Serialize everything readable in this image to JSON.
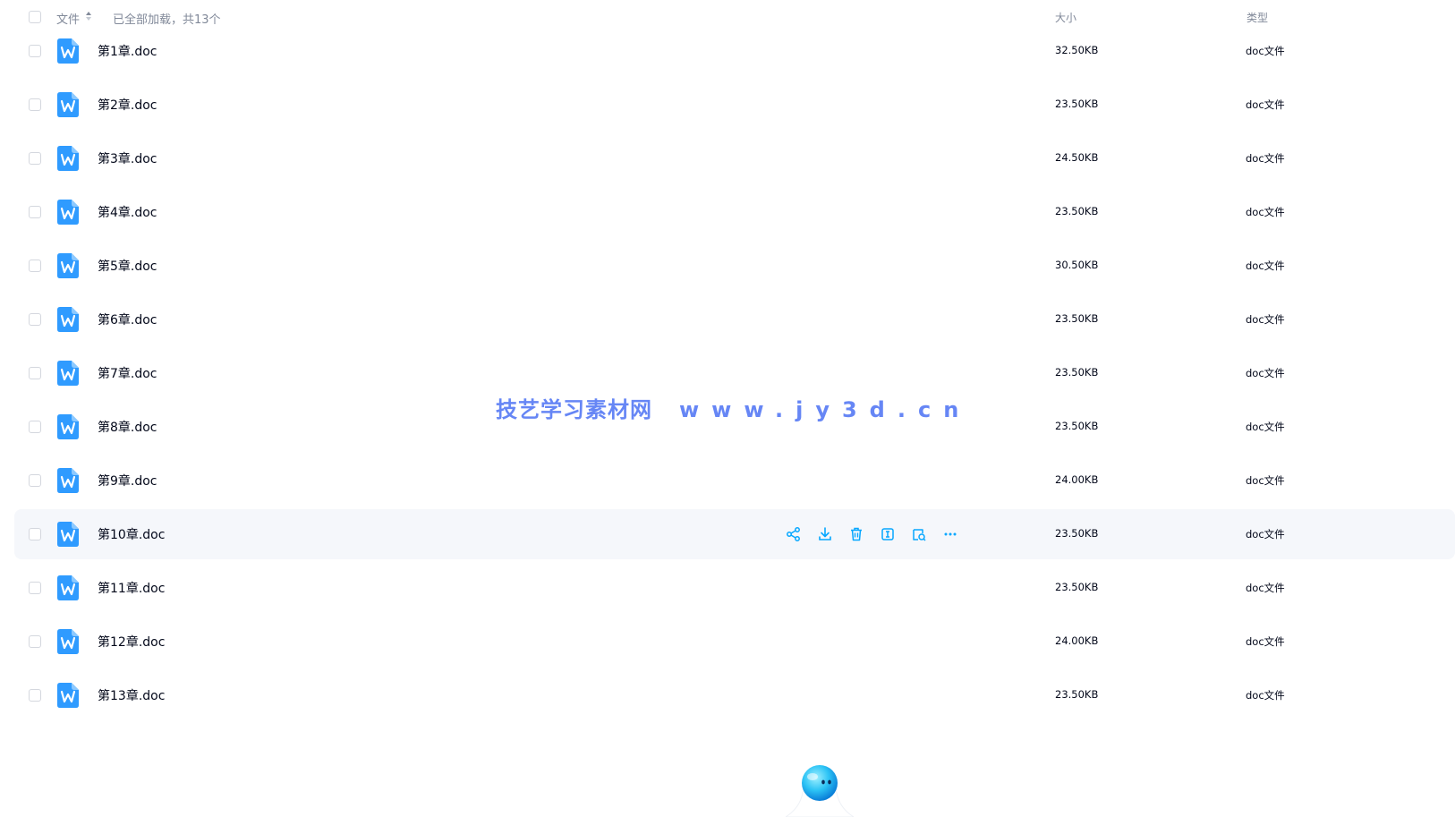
{
  "header": {
    "name_label": "文件",
    "loaded_text": "已全部加载，共13个",
    "size_label": "大小",
    "type_label": "类型"
  },
  "files": [
    {
      "name": "第1章.doc",
      "size": "32.50KB",
      "type": "doc文件"
    },
    {
      "name": "第2章.doc",
      "size": "23.50KB",
      "type": "doc文件"
    },
    {
      "name": "第3章.doc",
      "size": "24.50KB",
      "type": "doc文件"
    },
    {
      "name": "第4章.doc",
      "size": "23.50KB",
      "type": "doc文件"
    },
    {
      "name": "第5章.doc",
      "size": "30.50KB",
      "type": "doc文件"
    },
    {
      "name": "第6章.doc",
      "size": "23.50KB",
      "type": "doc文件"
    },
    {
      "name": "第7章.doc",
      "size": "23.50KB",
      "type": "doc文件"
    },
    {
      "name": "第8章.doc",
      "size": "23.50KB",
      "type": "doc文件"
    },
    {
      "name": "第9章.doc",
      "size": "24.00KB",
      "type": "doc文件"
    },
    {
      "name": "第10章.doc",
      "size": "23.50KB",
      "type": "doc文件"
    },
    {
      "name": "第11章.doc",
      "size": "23.50KB",
      "type": "doc文件"
    },
    {
      "name": "第12章.doc",
      "size": "24.00KB",
      "type": "doc文件"
    },
    {
      "name": "第13章.doc",
      "size": "23.50KB",
      "type": "doc文件"
    }
  ],
  "hover_actions": [
    "share-icon",
    "download-icon",
    "delete-icon",
    "rename-icon",
    "move-icon",
    "more-icon"
  ],
  "watermark": {
    "site_name": "技艺学习素材网",
    "url": "www.jy3d.cn"
  },
  "icons": {
    "file": "word-doc-icon",
    "assistant": "ai-assistant-mascot-icon"
  },
  "colors": {
    "accent": "#06a7ff",
    "text": "#03081a",
    "muted": "#818999",
    "hover_row": "#f5f7fb",
    "watermark": "#4c72f4"
  }
}
